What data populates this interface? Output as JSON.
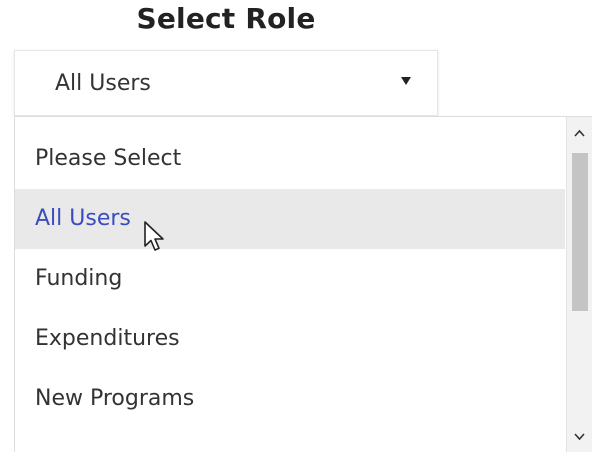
{
  "heading": "Select Role",
  "select": {
    "value": "All Users"
  },
  "dropdown": {
    "options": [
      {
        "label": "Please Select"
      },
      {
        "label": "All Users"
      },
      {
        "label": "Funding"
      },
      {
        "label": "Expenditures"
      },
      {
        "label": "New Programs"
      }
    ],
    "selected_index": 1
  },
  "colors": {
    "selected_text": "#3a4cc0",
    "selected_background": "#e9e9e9",
    "scrollbar_thumb": "#c4c4c4"
  },
  "icons": [
    "caret-down-icon",
    "chevron-up-icon",
    "chevron-down-icon",
    "mouse-pointer-icon"
  ]
}
